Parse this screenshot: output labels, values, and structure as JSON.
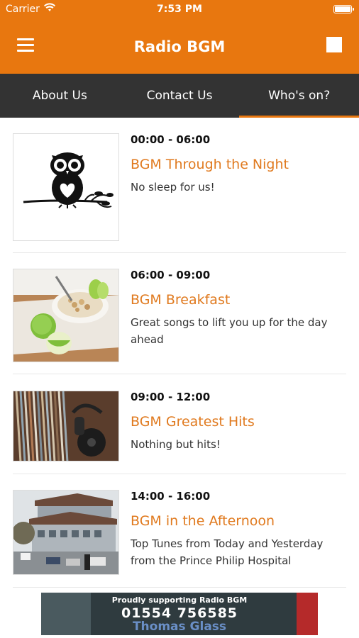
{
  "status_bar": {
    "carrier": "Carrier",
    "time": "7:53 PM"
  },
  "nav": {
    "title": "Radio BGM",
    "menu_icon": "hamburger-icon",
    "stop_icon": "stop-square-icon"
  },
  "tabs": [
    {
      "label": "About Us",
      "active": false
    },
    {
      "label": "Contact Us",
      "active": false
    },
    {
      "label": "Who's on?",
      "active": true
    }
  ],
  "schedule": [
    {
      "time": "00:00 - 06:00",
      "name": "BGM Through the Night",
      "description": "No sleep for us!",
      "image": "owl-illustration"
    },
    {
      "time": "06:00 - 09:00",
      "name": "BGM Breakfast",
      "description": "Great songs to lift you up for the day ahead",
      "image": "breakfast-bowl-photo"
    },
    {
      "time": "09:00 - 12:00",
      "name": "BGM Greatest Hits",
      "description": "Nothing but hits!",
      "image": "records-headphones-photo"
    },
    {
      "time": "14:00 - 16:00",
      "name": "BGM in the Afternoon",
      "description": "Top Tunes from Today and Yesterday from the Prince Philip Hospital",
      "image": "hospital-building-photo"
    }
  ],
  "banner": {
    "tagline": "Proudly supporting Radio BGM",
    "phone": "01554 756585",
    "brand": "Thomas Glass"
  },
  "colors": {
    "accent": "#e8770f",
    "tab_bar": "#333333",
    "show_title": "#e07a1f"
  }
}
